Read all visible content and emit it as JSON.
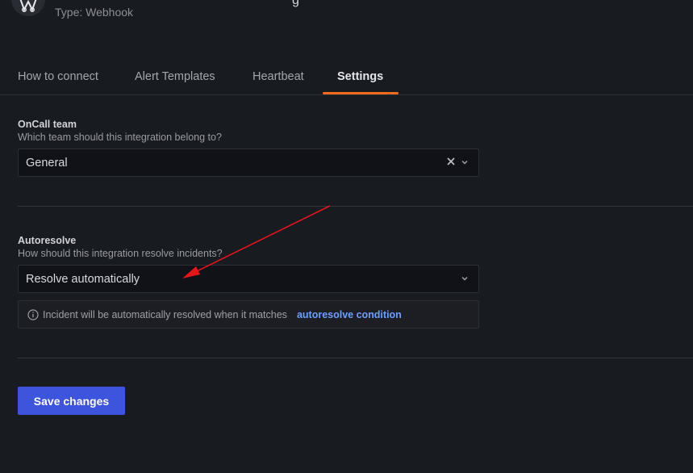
{
  "header": {
    "title_partial": "g",
    "subtitle": "Type: Webhook"
  },
  "tabs": [
    {
      "label": "How to connect",
      "active": false
    },
    {
      "label": "Alert Templates",
      "active": false
    },
    {
      "label": "Heartbeat",
      "active": false
    },
    {
      "label": "Settings",
      "active": true
    }
  ],
  "team": {
    "label": "OnCall team",
    "description": "Which team should this integration belong to?",
    "value": "General"
  },
  "autoresolve": {
    "label": "Autoresolve",
    "description": "How should this integration resolve incidents?",
    "value": "Resolve automatically",
    "info_text": "Incident will be automatically resolved when it matches",
    "info_link": "autoresolve condition"
  },
  "actions": {
    "save_label": "Save changes"
  },
  "colors": {
    "accent_tab": "#f56a1f",
    "primary_button": "#3d55dd",
    "link": "#6e9fff",
    "annotation_arrow": "#e8141b"
  }
}
